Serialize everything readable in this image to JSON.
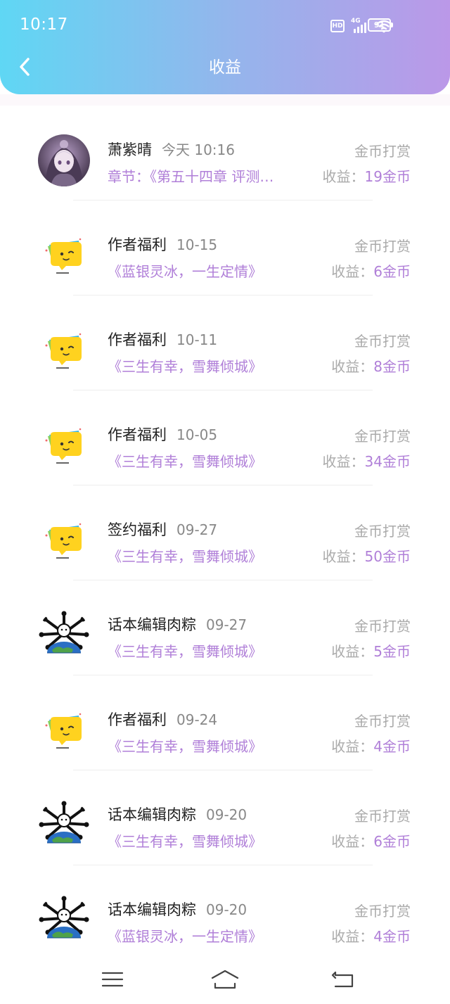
{
  "status_bar": {
    "time": "10:17",
    "hd": "HD",
    "network": "4G",
    "battery": "91"
  },
  "header": {
    "title": "收益"
  },
  "colors": {
    "accent": "#b07fd8",
    "header_gradient_start": "#5fd7f4",
    "header_gradient_end": "#bb98e8"
  },
  "records": [
    {
      "avatar": "anime-girl-avatar",
      "name": "萧紫晴",
      "date": "今天 10:16",
      "type": "金币打赏",
      "book": "章节：《第五十四章  评测…",
      "earning_label": "收益：",
      "amount": "19金币"
    },
    {
      "avatar": "yellow-chat-bubble-avatar",
      "name": "作者福利",
      "date": "10-15",
      "type": "金币打赏",
      "book": "《蓝银灵冰，一生定情》",
      "earning_label": "收益：",
      "amount": "6金币"
    },
    {
      "avatar": "yellow-chat-bubble-avatar",
      "name": "作者福利",
      "date": "10-11",
      "type": "金币打赏",
      "book": "《三生有幸，雪舞倾城》",
      "earning_label": "收益：",
      "amount": "8金币"
    },
    {
      "avatar": "yellow-chat-bubble-avatar",
      "name": "作者福利",
      "date": "10-05",
      "type": "金币打赏",
      "book": "《三生有幸，雪舞倾城》",
      "earning_label": "收益：",
      "amount": "34金币"
    },
    {
      "avatar": "yellow-chat-bubble-avatar",
      "name": "签约福利",
      "date": "09-27",
      "type": "金币打赏",
      "book": "《三生有幸，雪舞倾城》",
      "earning_label": "收益：",
      "amount": "50金币"
    },
    {
      "avatar": "globe-cartoon-avatar",
      "name": "话本编辑肉粽",
      "date": "09-27",
      "type": "金币打赏",
      "book": "《三生有幸，雪舞倾城》",
      "earning_label": "收益：",
      "amount": "5金币"
    },
    {
      "avatar": "yellow-chat-bubble-avatar",
      "name": "作者福利",
      "date": "09-24",
      "type": "金币打赏",
      "book": "《三生有幸，雪舞倾城》",
      "earning_label": "收益：",
      "amount": "4金币"
    },
    {
      "avatar": "globe-cartoon-avatar",
      "name": "话本编辑肉粽",
      "date": "09-20",
      "type": "金币打赏",
      "book": "《三生有幸，雪舞倾城》",
      "earning_label": "收益：",
      "amount": "6金币"
    },
    {
      "avatar": "globe-cartoon-avatar",
      "name": "话本编辑肉粽",
      "date": "09-20",
      "type": "金币打赏",
      "book": "《蓝银灵冰，一生定情》",
      "earning_label": "收益：",
      "amount": "4金币"
    }
  ],
  "navbar": {
    "icons": [
      "menu-icon",
      "home-icon",
      "back-icon"
    ]
  }
}
